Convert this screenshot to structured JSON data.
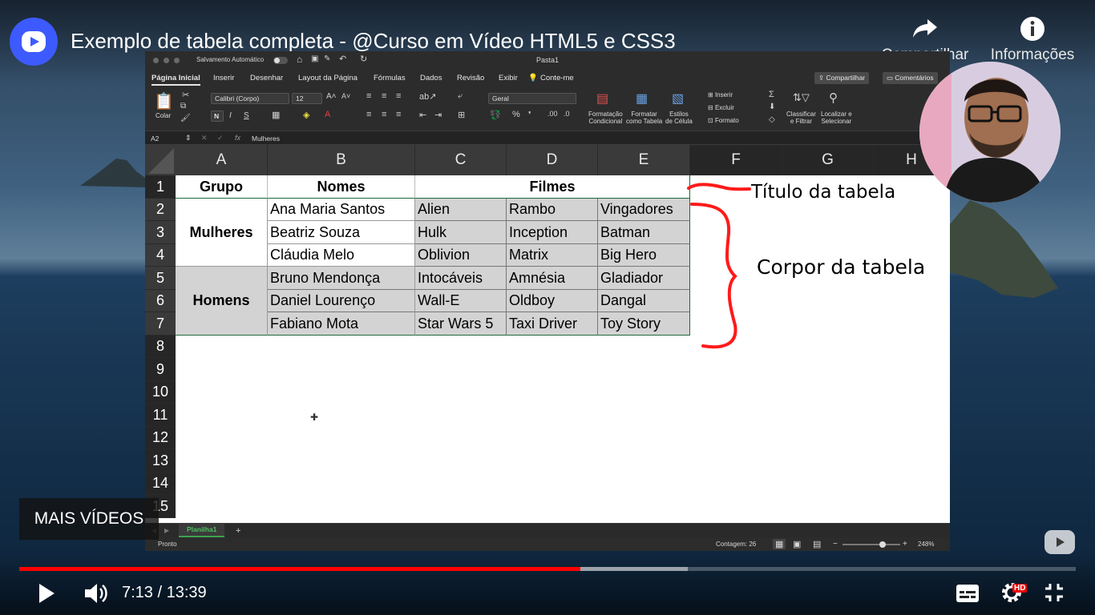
{
  "video": {
    "title": "Exemplo de tabela completa - @Curso em Vídeo HTML5 e CSS3",
    "share_label": "Compartilhar",
    "info_label": "Informações",
    "more_videos": "MAIS VÍDEOS",
    "time": "7:13 / 13:39",
    "progress_fraction": 0.531,
    "buffered_fraction": 0.633,
    "hd_badge": "HD",
    "accent_color": "#ff0000"
  },
  "excel": {
    "autosave_label": "Salvamento Automático",
    "doc_title": "Pasta1",
    "tabs": [
      "Página Inicial",
      "Inserir",
      "Desenhar",
      "Layout da Página",
      "Fórmulas",
      "Dados",
      "Revisão",
      "Exibir",
      "Conte-me"
    ],
    "share_btn": "Compartilhar",
    "comments_btn": "Comentários",
    "ribbon": {
      "paste": "Colar",
      "font": "Calibri (Corpo)",
      "size": "12",
      "bold": "N",
      "italic": "I",
      "underline": "S",
      "number_format": "Geral",
      "cond_format_1": "Formatação",
      "cond_format_2": "Condicional",
      "format_table_1": "Formatar",
      "format_table_2": "como Tabela",
      "cell_styles_1": "Estilos",
      "cell_styles_2": "de Célula",
      "insert": "Inserir",
      "delete": "Excluir",
      "format": "Formato",
      "sort_1": "Classificar",
      "sort_2": "e Filtrar",
      "find_1": "Localizar e",
      "find_2": "Selecionar"
    },
    "name_box": "A2",
    "fx": "fx",
    "formula": "Mulheres",
    "columns": [
      "A",
      "B",
      "C",
      "D",
      "E",
      "F",
      "G",
      "H"
    ],
    "rows": [
      "1",
      "2",
      "3",
      "4",
      "5",
      "6",
      "7",
      "8",
      "9",
      "10",
      "11",
      "12",
      "13",
      "14",
      "15"
    ],
    "header": {
      "grupo": "Grupo",
      "nomes": "Nomes",
      "filmes": "Filmes"
    },
    "groups": [
      "Mulheres",
      "Homens"
    ],
    "names": [
      "Ana Maria Santos",
      "Beatriz Souza",
      "Cláudia Melo",
      "Bruno Mendonça",
      "Daniel Lourenço",
      "Fabiano Mota"
    ],
    "movies": [
      [
        "Alien",
        "Rambo",
        "Vingadores"
      ],
      [
        "Hulk",
        "Inception",
        "Batman"
      ],
      [
        "Oblivion",
        "Matrix",
        "Big Hero"
      ],
      [
        "Intocáveis",
        "Amnésia",
        "Gladiador"
      ],
      [
        "Wall-E",
        "Oldboy",
        "Dangal"
      ],
      [
        "Star Wars 5",
        "Taxi Driver",
        "Toy Story"
      ]
    ],
    "annotations": {
      "title": "Título da tabela",
      "body": "Corpor da tabela"
    },
    "sheet_tab": "Planilha1",
    "add_sheet": "+",
    "status_ready": "Pronto",
    "status_count": "Contagem: 26",
    "zoom_minus": "−",
    "zoom_plus": "+",
    "zoom": "248%"
  }
}
